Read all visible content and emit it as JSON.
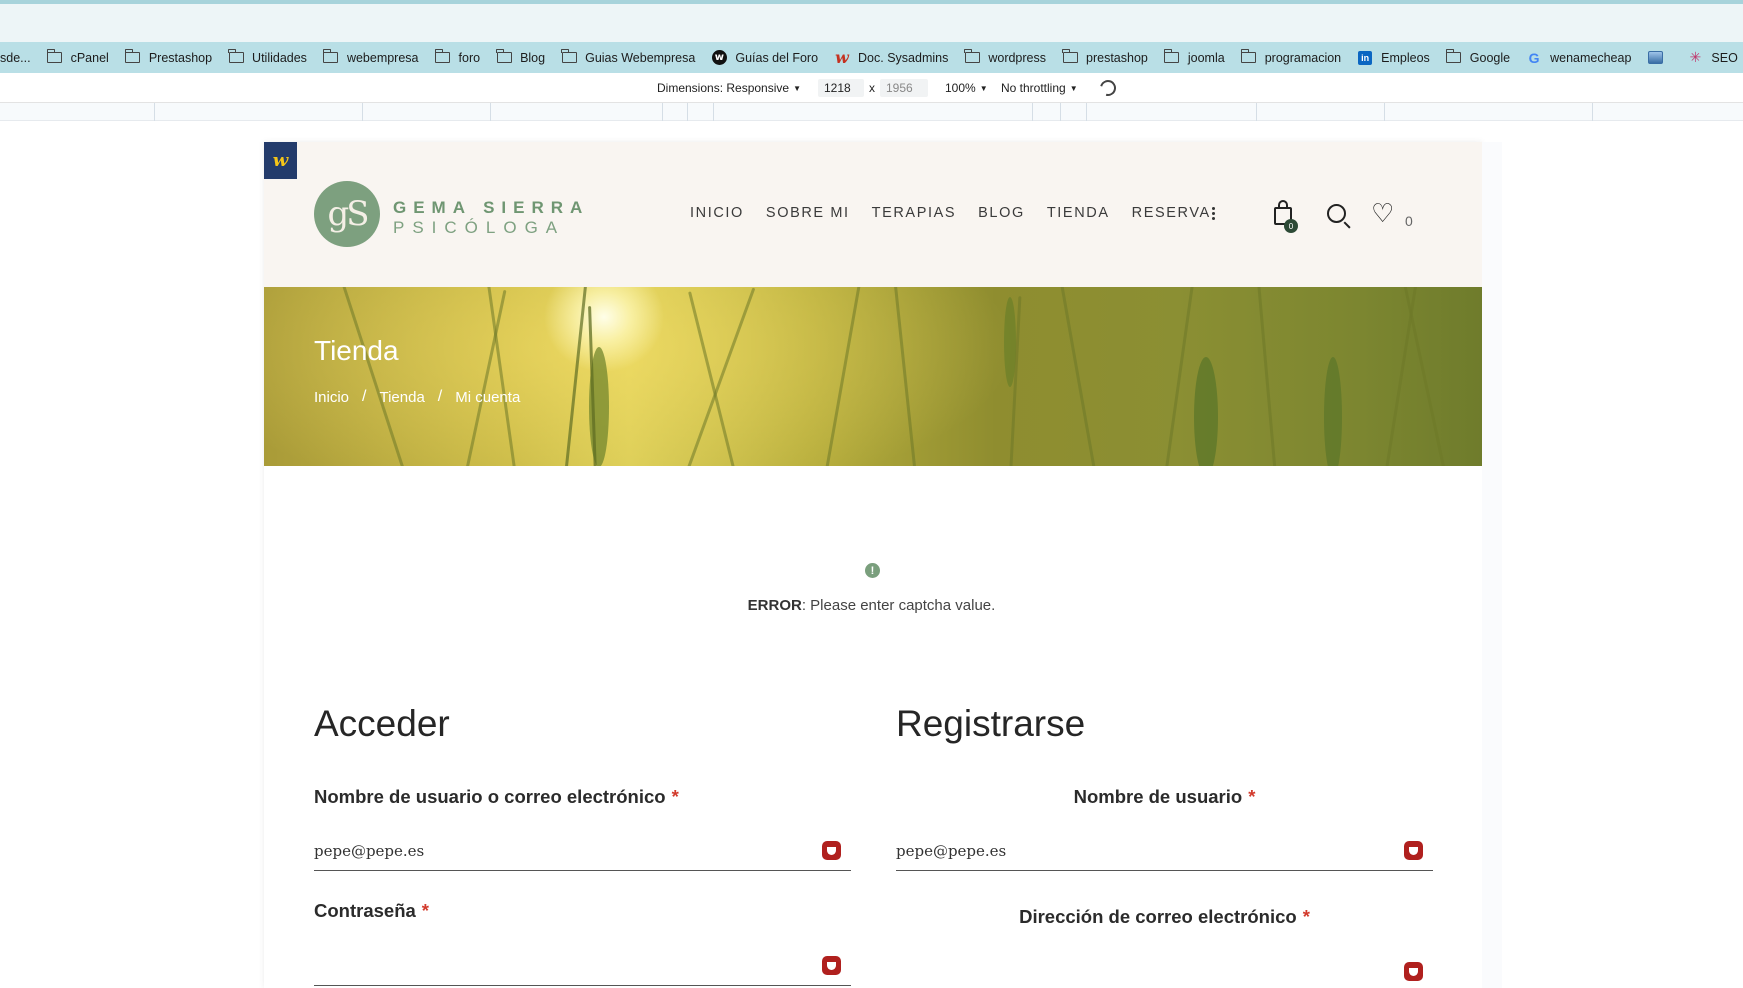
{
  "bookmarks": [
    {
      "label": "sde...",
      "icon": "none"
    },
    {
      "label": "cPanel",
      "icon": "folder-icon"
    },
    {
      "label": "Prestashop",
      "icon": "folder-icon"
    },
    {
      "label": "Utilidades",
      "icon": "folder-icon"
    },
    {
      "label": "webempresa",
      "icon": "folder-icon"
    },
    {
      "label": "foro",
      "icon": "folder-icon"
    },
    {
      "label": "Blog",
      "icon": "folder-icon"
    },
    {
      "label": "Guias Webempresa",
      "icon": "folder-icon"
    },
    {
      "label": "Guías del Foro",
      "icon": "webempresa-circle-icon"
    },
    {
      "label": "Doc. Sysadmins",
      "icon": "webempresa-red-icon"
    },
    {
      "label": "wordpress",
      "icon": "folder-icon"
    },
    {
      "label": "prestashop",
      "icon": "folder-icon"
    },
    {
      "label": "joomla",
      "icon": "folder-icon"
    },
    {
      "label": "programacion",
      "icon": "folder-icon"
    },
    {
      "label": "Empleos",
      "icon": "linkedin-icon"
    },
    {
      "label": "Google",
      "icon": "folder-icon"
    },
    {
      "label": "wenamecheap",
      "icon": "google-icon"
    },
    {
      "label": "",
      "icon": "image-icon"
    },
    {
      "label": "SEO",
      "icon": "star-icon"
    }
  ],
  "devtools": {
    "dimensions_label": "Dimensions: Responsive",
    "width": "1218",
    "times": "x",
    "height_placeholder": "1956",
    "zoom": "100%",
    "throttling": "No throttling"
  },
  "site": {
    "badge_letter": "w",
    "logo_initials": "gS",
    "logo_name": "GEMA SIERRA",
    "logo_sub": "PSICÓLOGA",
    "nav": [
      "INICIO",
      "SOBRE MI",
      "TERAPIAS",
      "BLOG",
      "TIENDA",
      "RESERVA"
    ],
    "cart_count": "0",
    "wishlist_count": "0",
    "hero": {
      "title": "Tienda",
      "breadcrumbs": [
        "Inicio",
        "Tienda",
        "Mi cuenta"
      ],
      "separator": "/"
    },
    "notice": {
      "icon": "!",
      "strong": "ERROR",
      "message": ": Please enter captcha value."
    },
    "login": {
      "heading": "Acceder",
      "username_label": "Nombre de usuario o correo electrónico",
      "username_value": "pepe@pepe.es",
      "password_label": "Contraseña",
      "password_value": "",
      "required_mark": "*"
    },
    "register": {
      "heading": "Registrarse",
      "username_label": "Nombre de usuario",
      "username_value": "pepe@pepe.es",
      "email_label": "Dirección de correo electrónico",
      "required_mark": "*"
    }
  }
}
